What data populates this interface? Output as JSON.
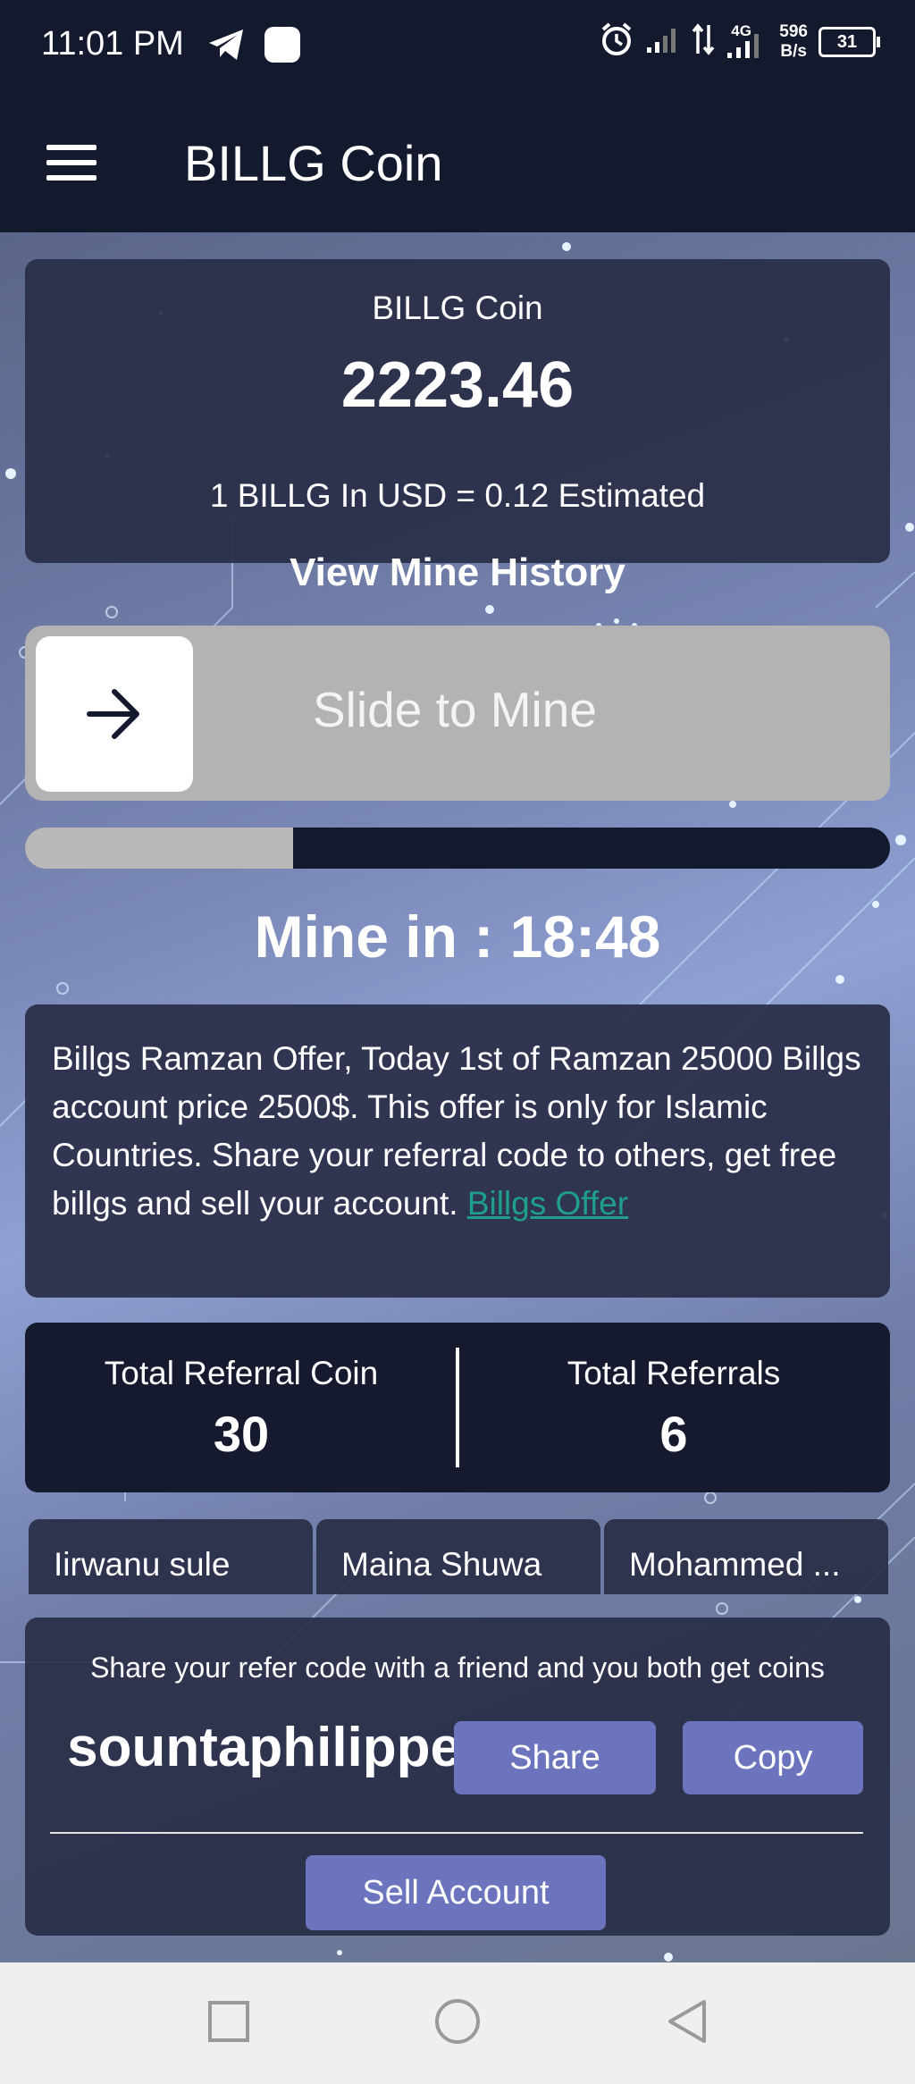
{
  "status_bar": {
    "time": "11:01 PM",
    "network_type": "4G",
    "speed_value": "596",
    "speed_unit": "B/s",
    "battery": "31",
    "icons": [
      "telegram-icon",
      "app-icon",
      "alarm-icon",
      "signal-icon",
      "data-arrows-icon",
      "signal-4g-icon",
      "battery-icon"
    ]
  },
  "app_bar": {
    "title": "BILLG Coin",
    "menu_icon": "hamburger-menu-icon"
  },
  "balance": {
    "label": "BILLG Coin",
    "value": "2223.46",
    "rate": "1 BILLG In USD = 0.12 Estimated",
    "history_link": "View Mine History"
  },
  "slider": {
    "label": "Slide to Mine",
    "icon": "arrow-right-icon"
  },
  "mining_progress": {
    "fraction": 0.31
  },
  "timer": {
    "text": "Mine in : 18:48"
  },
  "offer": {
    "text": "Billgs Ramzan Offer, Today 1st of Ramzan 25000 Billgs account price 2500$. This offer is only for Islamic Countries. Share your referral code to others, get free billgs and sell your account. ",
    "link_text": "Billgs Offer "
  },
  "stats": {
    "referral_coin_label": "Total Referral Coin",
    "referral_coin_value": "30",
    "referrals_label": "Total Referrals",
    "referrals_value": "6"
  },
  "referrals": [
    {
      "name": "Iirwanu sule"
    },
    {
      "name": "Maina Shuwa"
    },
    {
      "name": "Mohammed ..."
    }
  ],
  "share": {
    "hint": "Share your refer code with a friend and you both get coins",
    "code": "sountaphilippe",
    "share_label": "Share",
    "copy_label": "Copy",
    "sell_label": "Sell Account"
  },
  "nav": {
    "icons": [
      "recent-apps-icon",
      "home-icon",
      "back-icon"
    ]
  },
  "colors": {
    "header_bg": "#141a2e",
    "card_bg": "#282c46",
    "button_bg": "#6b74bd",
    "link": "#1f9e89"
  }
}
